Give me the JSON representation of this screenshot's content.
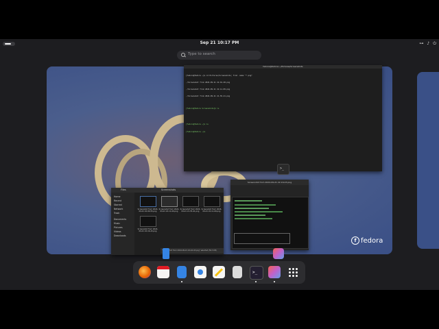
{
  "topbar": {
    "clock": "Sep 21  10:17 PM",
    "tray": [
      "⊶",
      "♪",
      "⏻"
    ]
  },
  "search": {
    "placeholder": "Type to search"
  },
  "workspace": {
    "brand": "fedora",
    "brand_mark": "f"
  },
  "terminal": {
    "title": "fedora@fedora:~/Pictures/Screenshots",
    "lines": [
      "[fedora@fedora ~]$ cd Pictures/Screenshots; find -name \"*.png\"",
      "./Screenshot from 2024-09-21 22-01-28.png",
      "./Screenshot from 2024-09-21 22-11-09.png",
      "./Screenshot from 2024-09-21 21-55-41.png",
      "",
      "[fedora@fedora Screenshots]$ ls",
      "",
      "",
      "[fedora@fedora ~]$ ls",
      "[fedora@fedora ~]$ "
    ]
  },
  "files": {
    "title": "Files",
    "breadcrumb": "Screenshots",
    "sidebar": [
      "Home",
      "Recent",
      "Starred",
      "Network",
      "Trash",
      "Documents",
      "Music",
      "Pictures",
      "Videos",
      "Downloads"
    ],
    "items": [
      {
        "name": "Screenshot from 2024-09-21 22-00-55.png"
      },
      {
        "name": "Screenshot from 2024-09-21 22-11-09.png"
      },
      {
        "name": "Screenshot from 2024-09-21 21-55-41.png"
      },
      {
        "name": "Screenshot from 2024-09-21 22-11-09.png"
      },
      {
        "name": "Screenshot from 2024-09-21 22-16-43.png"
      }
    ],
    "status": "\"Screenshot from 2024-09-21 22-16-43.png\" selected (50.3 kB)"
  },
  "viewer": {
    "title": "Screenshot from 2024-09-21 22-16-43.png"
  },
  "dock": {
    "apps": [
      {
        "name": "firefox",
        "color": "#e66000"
      },
      {
        "name": "calendar",
        "color": "#f6f5f4"
      },
      {
        "name": "files",
        "color": "#3584e4"
      },
      {
        "name": "software",
        "color": "#f6f5f4"
      },
      {
        "name": "text-editor",
        "color": "#f5c211"
      },
      {
        "name": "calculator",
        "color": "#dcdcdc"
      },
      {
        "name": "terminal",
        "color": "#241f31"
      },
      {
        "name": "image-viewer",
        "color": "#c061cb"
      }
    ]
  }
}
